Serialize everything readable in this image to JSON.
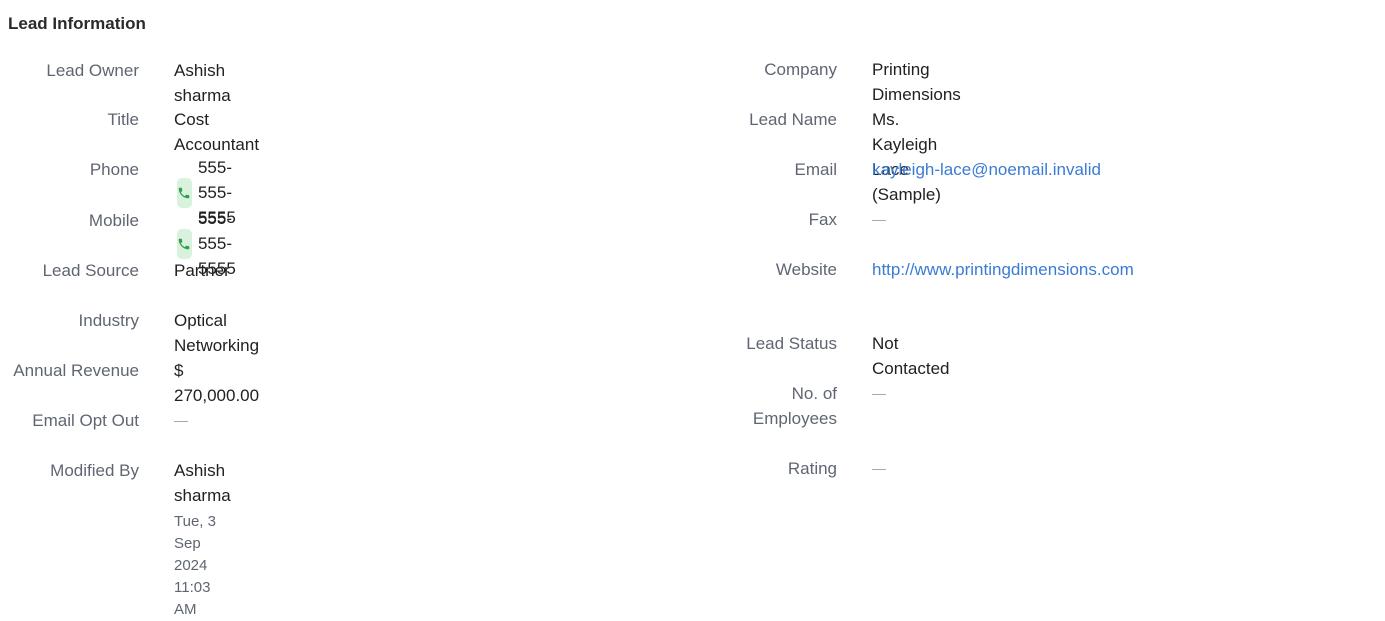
{
  "section": {
    "title": "Lead Information"
  },
  "left": {
    "lead_owner": {
      "label": "Lead Owner",
      "value": "Ashish sharma"
    },
    "title": {
      "label": "Title",
      "value": "Cost Accountant"
    },
    "phone": {
      "label": "Phone",
      "value": "555-555-5555",
      "icon": "phone-icon"
    },
    "mobile": {
      "label": "Mobile",
      "value": "555-555-5555",
      "icon": "phone-icon"
    },
    "lead_source": {
      "label": "Lead Source",
      "value": "Partner"
    },
    "industry": {
      "label": "Industry",
      "value": "Optical Networking"
    },
    "annual_revenue": {
      "label": "Annual Revenue",
      "value": "$ 270,000.00"
    },
    "email_opt_out": {
      "label": "Email Opt Out",
      "value": "—"
    },
    "modified_by": {
      "label": "Modified By",
      "value": "Ashish sharma",
      "timestamp": "Tue, 3 Sep 2024 11:03 AM"
    }
  },
  "right": {
    "company": {
      "label": "Company",
      "value": "Printing Dimensions"
    },
    "lead_name": {
      "label": "Lead Name",
      "value": "Ms. Kayleigh Lace (Sample)"
    },
    "email": {
      "label": "Email",
      "value": "kayleigh-lace@noemail.invalid"
    },
    "fax": {
      "label": "Fax",
      "value": "—"
    },
    "website": {
      "label": "Website",
      "value": "http://www.printingdimensions.com"
    },
    "lead_status": {
      "label": "Lead Status",
      "value": "Not Contacted"
    },
    "no_of_employees": {
      "label": "No. of Employees",
      "value": "—"
    },
    "rating": {
      "label": "Rating",
      "value": "—"
    }
  },
  "colors": {
    "link": "#3a7bd5",
    "label": "#5f6672",
    "phone_icon_bg": "#d9f2de",
    "phone_icon_fg": "#2e9e4f"
  }
}
